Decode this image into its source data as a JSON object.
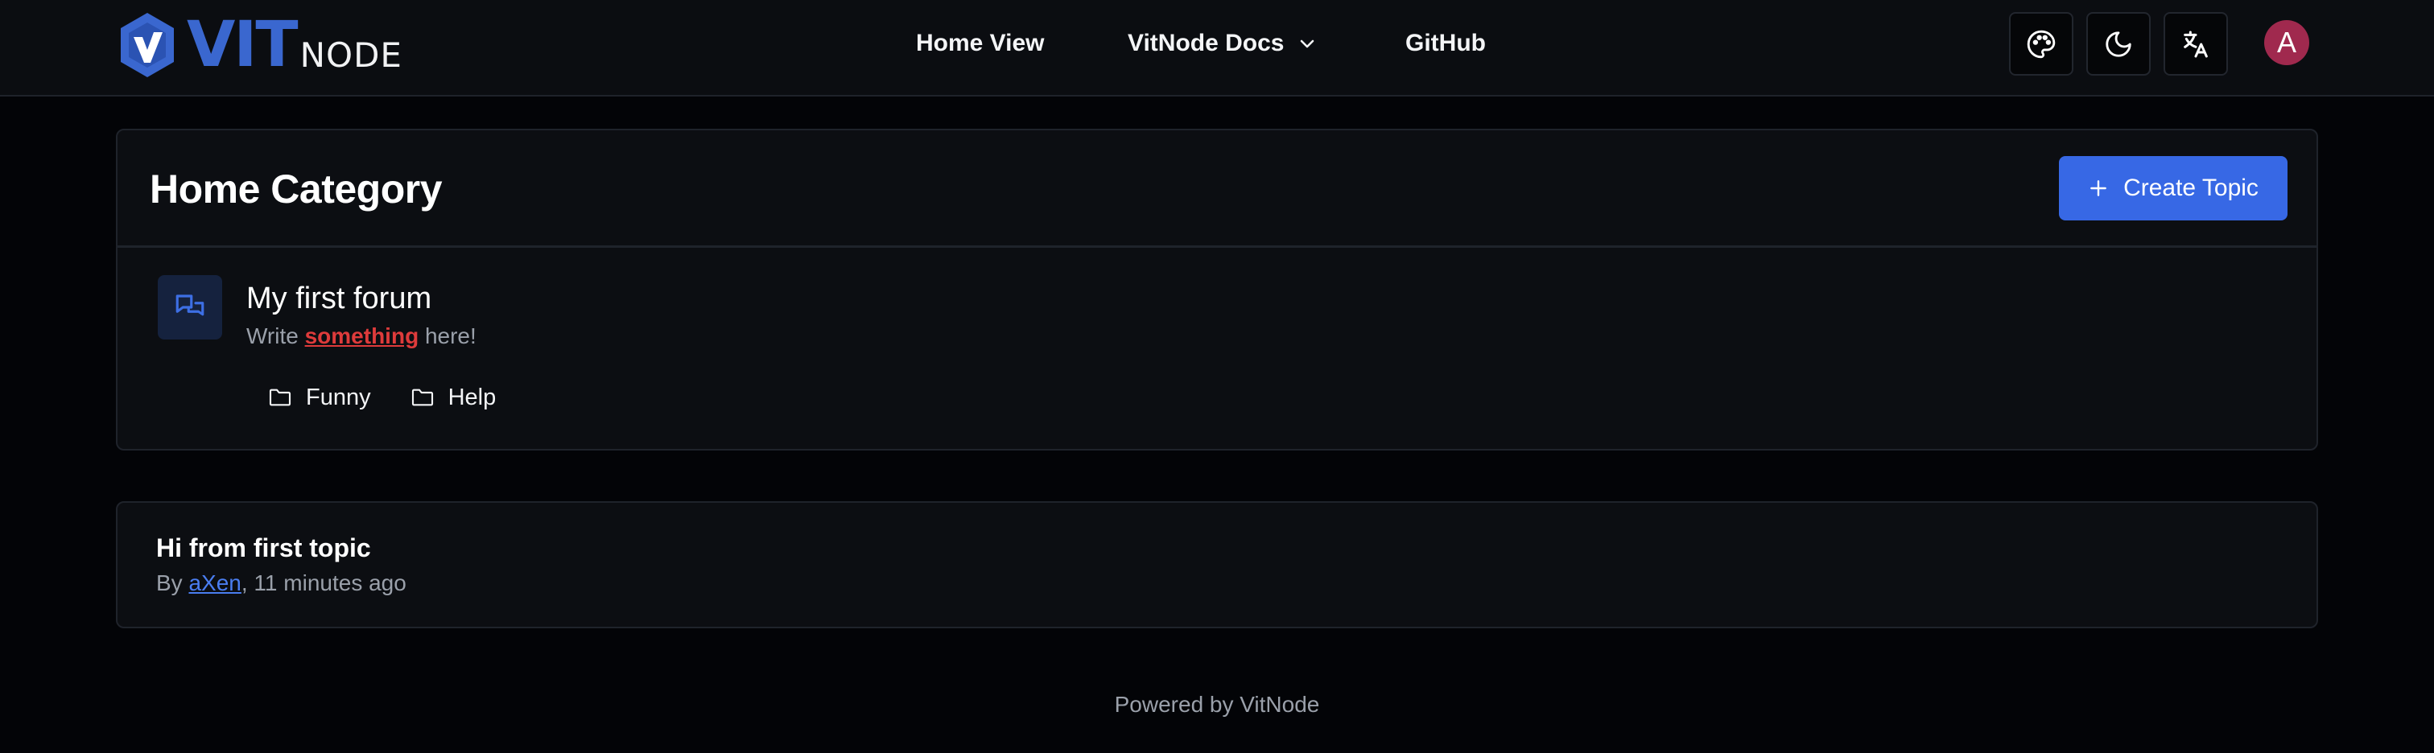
{
  "brand": {
    "logo_main": "VIT",
    "logo_sub": "NODE",
    "accent": "#3a67cf"
  },
  "nav": {
    "items": [
      {
        "label": "Home View"
      },
      {
        "label": "VitNode Docs",
        "icon": "chevron-down-icon"
      },
      {
        "label": "GitHub"
      }
    ]
  },
  "header_actions": {
    "palette_icon": "palette-icon",
    "theme_icon": "moon-icon",
    "language_icon": "translate-icon",
    "avatar_letter": "A",
    "avatar_color": "#a0294e"
  },
  "category": {
    "title": "Home Category",
    "create_button": "Create Topic",
    "create_button_color": "#3768e5",
    "forum": {
      "title": "My first forum",
      "description_before": "Write ",
      "description_emphasis": "something",
      "description_after": " here!",
      "icon": "messages-icon",
      "subforums": [
        {
          "label": "Funny",
          "icon": "folder-icon"
        },
        {
          "label": "Help",
          "icon": "folder-icon"
        }
      ]
    }
  },
  "topics": [
    {
      "title": "Hi from first topic",
      "by_label": "By ",
      "author": "aXen",
      "time": ", 11 minutes ago"
    }
  ],
  "footer": {
    "text": "Powered by VitNode"
  }
}
